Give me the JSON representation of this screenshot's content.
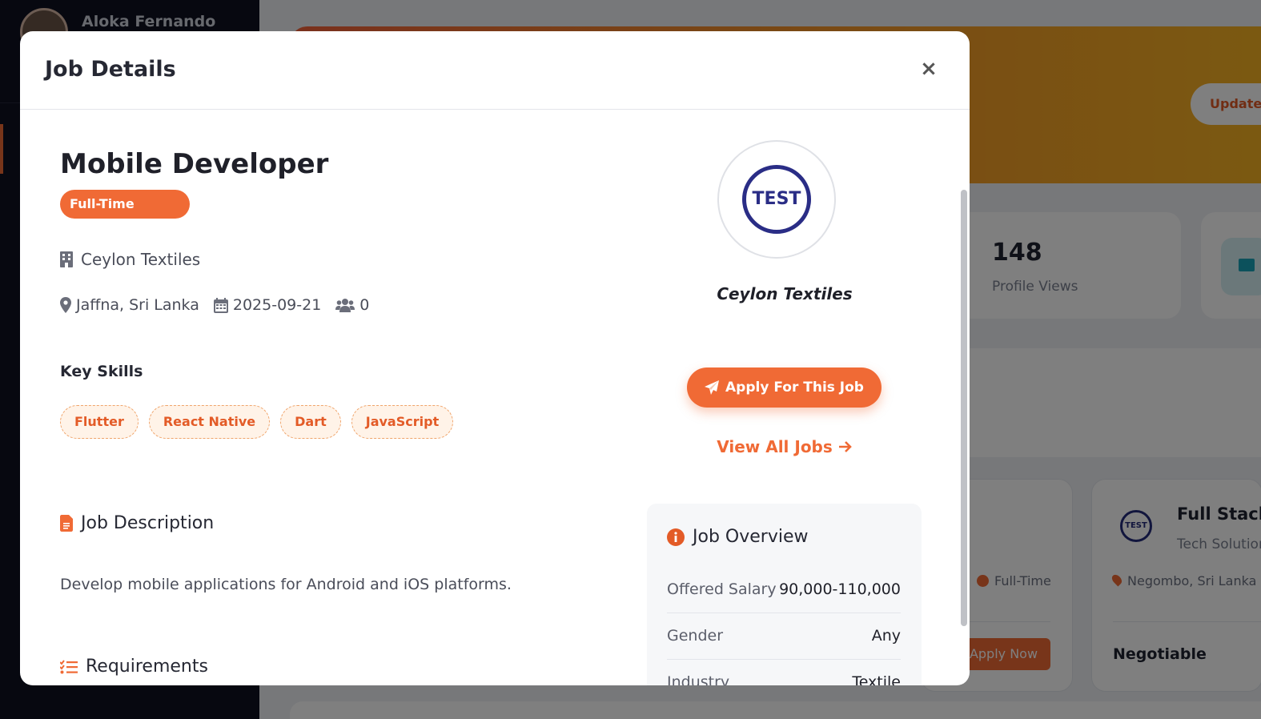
{
  "background": {
    "user_name": "Aloka Fernando",
    "update_button": "Update",
    "stat_value": "148",
    "stat_label": "Profile Views",
    "job_card_1": {
      "type": "Full-Time",
      "apply_label": "Apply Now"
    },
    "job_card_2": {
      "logo_text": "TEST",
      "title": "Full Stack",
      "company": "Tech Solution",
      "location": "Negombo, Sri Lanka",
      "salary": "Negotiable"
    }
  },
  "modal": {
    "title": "Job Details",
    "close_icon": "×"
  },
  "job": {
    "title": "Mobile Developer",
    "type": "Full-Time",
    "company": "Ceylon Textiles",
    "location": "Jaffna, Sri Lanka",
    "date": "2025-09-21",
    "applicants": "0",
    "skills_label": "Key Skills",
    "skills": [
      "Flutter",
      "React Native",
      "Dart",
      "JavaScript"
    ],
    "description_label": "Job Description",
    "description": "Develop mobile applications for Android and iOS platforms.",
    "requirements_label": "Requirements"
  },
  "sidebar_card": {
    "logo_text": "TEST",
    "company_name": "Ceylon Textiles",
    "apply_label": "Apply For This Job",
    "view_all_label": "View All Jobs"
  },
  "overview": {
    "title": "Job Overview",
    "rows": [
      {
        "key": "Offered Salary",
        "value": "90,000-110,000"
      },
      {
        "key": "Gender",
        "value": "Any"
      },
      {
        "key": "Industry",
        "value": "Textile"
      }
    ]
  },
  "colors": {
    "accent": "#f06a35",
    "logo_navy": "#2a2d86",
    "skill_bg": "#fff3e8"
  },
  "icons": {
    "company": "building-icon",
    "location": "map-pin-icon",
    "date": "calendar-icon",
    "applicants": "users-icon",
    "description": "file-icon",
    "requirements": "list-check-icon",
    "apply": "paper-plane-icon",
    "view_all": "arrow-right-icon",
    "overview": "info-circle-icon"
  }
}
